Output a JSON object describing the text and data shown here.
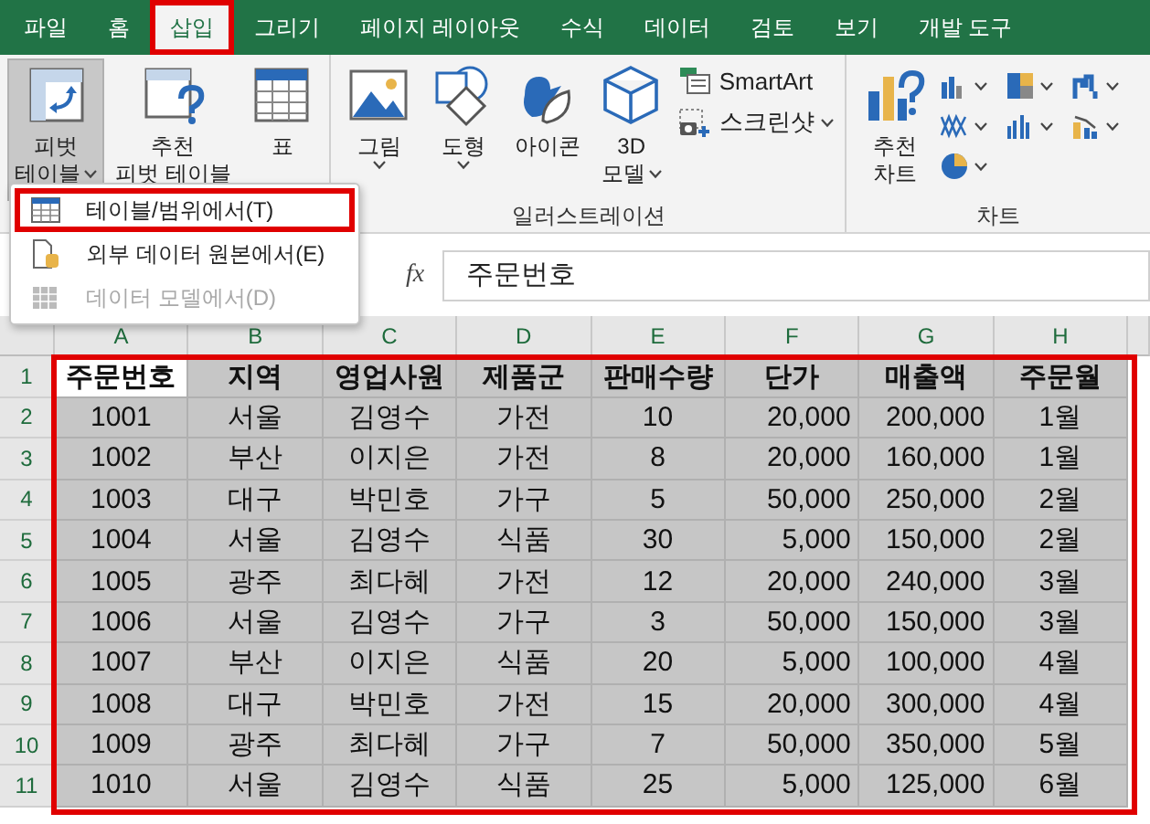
{
  "tabs": [
    {
      "label": "파일",
      "selected": false
    },
    {
      "label": "홈",
      "selected": false
    },
    {
      "label": "삽입",
      "selected": true,
      "highlighted": true
    },
    {
      "label": "그리기",
      "selected": false
    },
    {
      "label": "페이지 레이아웃",
      "selected": false
    },
    {
      "label": "수식",
      "selected": false
    },
    {
      "label": "데이터",
      "selected": false
    },
    {
      "label": "검토",
      "selected": false
    },
    {
      "label": "보기",
      "selected": false
    },
    {
      "label": "개발 도구",
      "selected": false
    }
  ],
  "ribbon": {
    "groups": [
      {
        "buttons": [
          {
            "kind": "large",
            "lines": [
              "피벗",
              "테이블"
            ],
            "dropdown": true,
            "pressed": true
          },
          {
            "kind": "large",
            "lines": [
              "추천",
              "피벗 테이블"
            ],
            "dropdown": false,
            "pressed": false
          },
          {
            "kind": "large",
            "lines": [
              "표"
            ],
            "dropdown": false,
            "pressed": false
          }
        ]
      },
      {
        "label": "일러스트레이션",
        "buttons": [
          {
            "kind": "large",
            "lines": [
              "그림"
            ],
            "dropdown": true,
            "pressed": false
          },
          {
            "kind": "large",
            "lines": [
              "도형"
            ],
            "dropdown": true,
            "pressed": false
          },
          {
            "kind": "large",
            "lines": [
              "아이콘"
            ],
            "dropdown": false,
            "pressed": false
          },
          {
            "kind": "large",
            "lines": [
              "3D",
              "모델"
            ],
            "dropdown": true,
            "pressed": false
          },
          {
            "kind": "small",
            "lines": [
              "SmartArt"
            ],
            "dropdown": false,
            "pressed": false
          },
          {
            "kind": "small",
            "lines": [
              "스크린샷"
            ],
            "dropdown": true,
            "pressed": false
          }
        ]
      },
      {
        "label": "차트",
        "buttons": [
          {
            "kind": "large",
            "lines": [
              "추천",
              "차트"
            ],
            "dropdown": false,
            "pressed": false
          },
          {
            "kind": "mini",
            "dropdown": true,
            "pressed": false
          },
          {
            "kind": "mini",
            "dropdown": true,
            "pressed": false
          },
          {
            "kind": "mini",
            "dropdown": true,
            "pressed": false
          },
          {
            "kind": "mini",
            "dropdown": true,
            "pressed": false
          },
          {
            "kind": "mini",
            "dropdown": true,
            "pressed": false
          },
          {
            "kind": "mini",
            "dropdown": true,
            "pressed": false
          },
          {
            "kind": "mini",
            "dropdown": true,
            "pressed": false
          }
        ]
      }
    ]
  },
  "menu": {
    "items": [
      {
        "label": "테이블/범위에서(T)",
        "disabled": false,
        "highlighted": true
      },
      {
        "label": "외부 데이터 원본에서(E)",
        "disabled": false,
        "highlighted": false
      },
      {
        "label": "데이터 모델에서(D)",
        "disabled": true,
        "highlighted": false
      }
    ]
  },
  "formula_bar": {
    "fx": "fx",
    "value": "주문번호"
  },
  "sheet": {
    "columns": [
      "A",
      "B",
      "C",
      "D",
      "E",
      "F",
      "G",
      "H"
    ],
    "selected": true,
    "highlighted": true,
    "rows": [
      {
        "number": "1",
        "header": true,
        "cells": [
          {
            "text": "주문번호",
            "active": true
          },
          {
            "text": "지역",
            "active": false
          },
          {
            "text": "영업사원",
            "active": false
          },
          {
            "text": "제품군",
            "active": false
          },
          {
            "text": "판매수량",
            "active": false
          },
          {
            "text": "단가",
            "active": false
          },
          {
            "text": "매출액",
            "active": false
          },
          {
            "text": "주문월",
            "active": false
          }
        ]
      },
      {
        "number": "2",
        "header": false,
        "cells": [
          "1001",
          "서울",
          "김영수",
          "가전",
          "10",
          "20,000",
          "200,000",
          "1월"
        ]
      },
      {
        "number": "3",
        "header": false,
        "cells": [
          "1002",
          "부산",
          "이지은",
          "가전",
          "8",
          "20,000",
          "160,000",
          "1월"
        ]
      },
      {
        "number": "4",
        "header": false,
        "cells": [
          "1003",
          "대구",
          "박민호",
          "가구",
          "5",
          "50,000",
          "250,000",
          "2월"
        ]
      },
      {
        "number": "5",
        "header": false,
        "cells": [
          "1004",
          "서울",
          "김영수",
          "식품",
          "30",
          "5,000",
          "150,000",
          "2월"
        ]
      },
      {
        "number": "6",
        "header": false,
        "cells": [
          "1005",
          "광주",
          "최다혜",
          "가전",
          "12",
          "20,000",
          "240,000",
          "3월"
        ]
      },
      {
        "number": "7",
        "header": false,
        "cells": [
          "1006",
          "서울",
          "김영수",
          "가구",
          "3",
          "50,000",
          "150,000",
          "3월"
        ]
      },
      {
        "number": "8",
        "header": false,
        "cells": [
          "1007",
          "부산",
          "이지은",
          "식품",
          "20",
          "5,000",
          "100,000",
          "4월"
        ]
      },
      {
        "number": "9",
        "header": false,
        "cells": [
          "1008",
          "대구",
          "박민호",
          "가전",
          "15",
          "20,000",
          "300,000",
          "4월"
        ]
      },
      {
        "number": "10",
        "header": false,
        "cells": [
          "1009",
          "광주",
          "최다혜",
          "가구",
          "7",
          "50,000",
          "350,000",
          "5월"
        ]
      },
      {
        "number": "11",
        "header": false,
        "cells": [
          "1010",
          "서울",
          "김영수",
          "식품",
          "25",
          "5,000",
          "125,000",
          "6월"
        ]
      }
    ]
  }
}
